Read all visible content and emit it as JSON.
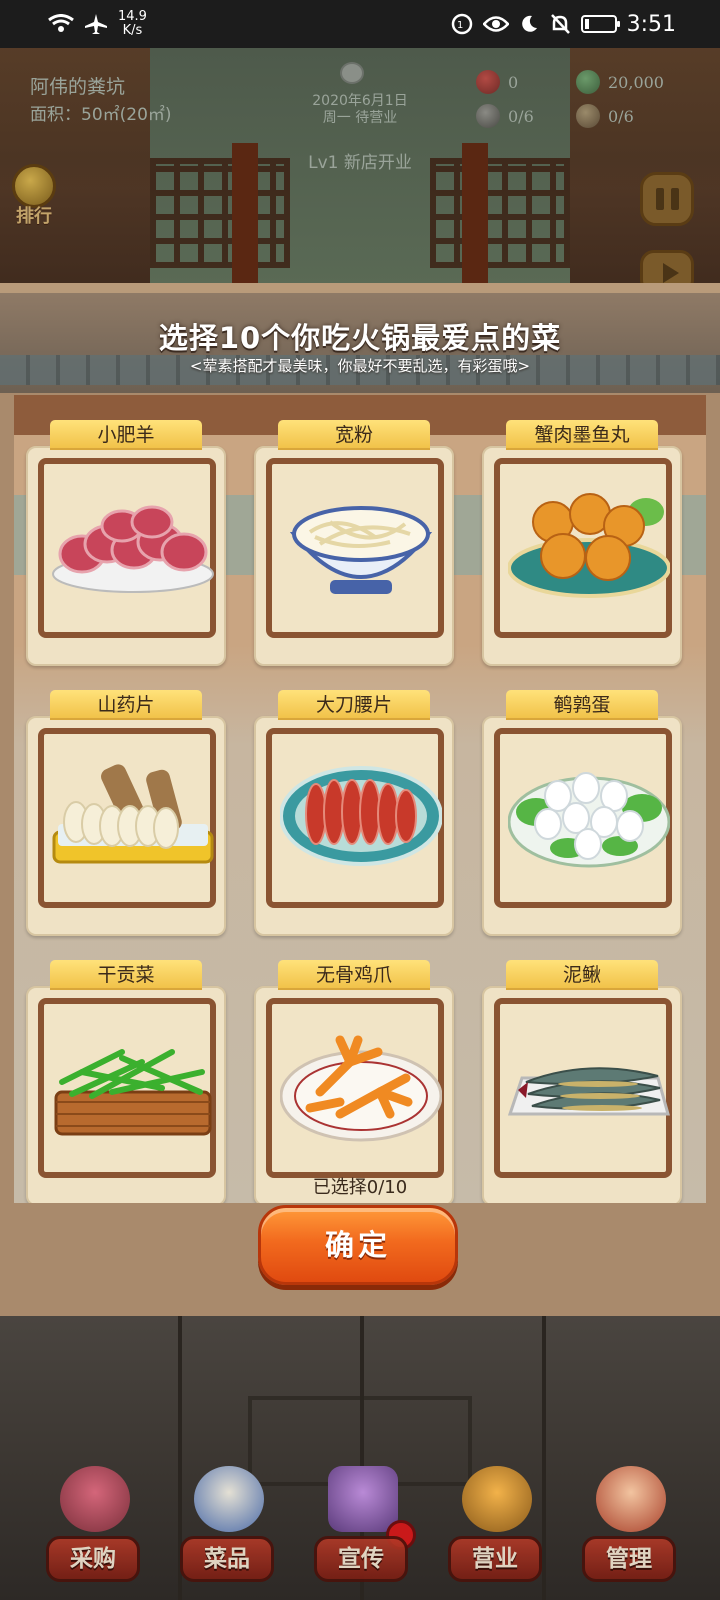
{
  "status_bar": {
    "network_speed_value": "14.9",
    "network_speed_unit": "K/s",
    "time": "3:51",
    "battery_level": 0.15
  },
  "game_header": {
    "shop_name": "阿伟的粪坑",
    "shop_area": "面积：50㎡(20㎡)",
    "date_line1": "2020年6月1日",
    "date_line2": "周一 待营业",
    "level_title": "Lv1 新店开业",
    "resources": [
      {
        "icon": "tomato-icon",
        "value": "0"
      },
      {
        "icon": "cash-icon",
        "value": "20,000"
      },
      {
        "icon": "chef-icon",
        "value": "0/6"
      },
      {
        "icon": "table-icon",
        "value": "0/6"
      }
    ],
    "rank_label": "排行"
  },
  "dialog": {
    "title": "选择10个你吃火锅最爱点的菜",
    "subtitle": "<荤素搭配才最美味，你最好不要乱选，有彩蛋哦>",
    "items": [
      {
        "name": "小肥羊",
        "icon": "lamb-slices-icon"
      },
      {
        "name": "宽粉",
        "icon": "wide-noodles-icon"
      },
      {
        "name": "蟹肉墨鱼丸",
        "icon": "fish-balls-icon"
      },
      {
        "name": "山药片",
        "icon": "yam-slices-icon"
      },
      {
        "name": "大刀腰片",
        "icon": "kidney-slices-icon"
      },
      {
        "name": "鹌鹑蛋",
        "icon": "quail-eggs-icon"
      },
      {
        "name": "干贡菜",
        "icon": "gonggai-vegetable-icon"
      },
      {
        "name": "无骨鸡爪",
        "icon": "chicken-feet-icon"
      },
      {
        "name": "泥鳅",
        "icon": "loach-fish-icon"
      }
    ],
    "selection_counter": "已选择0/10",
    "confirm_label": "确定"
  },
  "bottom_nav": [
    {
      "label": "采购",
      "icon": "shop-stall-icon"
    },
    {
      "label": "菜品",
      "icon": "hotpot-icon"
    },
    {
      "label": "宣传",
      "icon": "clapper-icon",
      "badge": true
    },
    {
      "label": "营业",
      "icon": "bell-cloche-icon"
    },
    {
      "label": "管理",
      "icon": "manager-girl-icon"
    }
  ]
}
